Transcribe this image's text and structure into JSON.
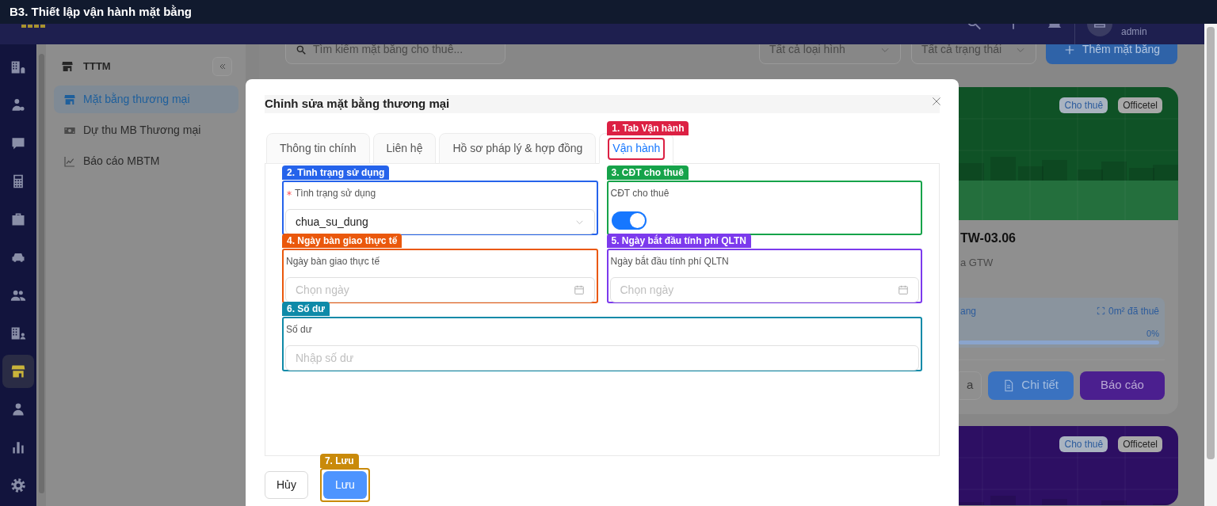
{
  "banner": {
    "title": "B3. Thiết lập vận hành mặt bằng"
  },
  "header": {
    "user": "admin"
  },
  "rail": [
    {
      "kind": "building",
      "selected": false
    },
    {
      "kind": "person_coin",
      "selected": false
    },
    {
      "kind": "chat",
      "selected": false
    },
    {
      "kind": "calculator",
      "selected": false
    },
    {
      "kind": "briefcase",
      "selected": false
    },
    {
      "kind": "car",
      "selected": false
    },
    {
      "kind": "people",
      "selected": false
    },
    {
      "kind": "building_person",
      "selected": false
    },
    {
      "kind": "store",
      "selected": true
    },
    {
      "kind": "person",
      "selected": false
    },
    {
      "kind": "chart",
      "selected": false
    },
    {
      "kind": "settings",
      "selected": false
    }
  ],
  "sidebar": {
    "title": "TTTM",
    "items": [
      {
        "label": "Mặt bằng thương mại",
        "kind": "store",
        "selected": true
      },
      {
        "label": "Dự thu MB Thương mại",
        "kind": "cash",
        "selected": false
      },
      {
        "label": "Báo cáo MBTM",
        "kind": "chart",
        "selected": false
      }
    ]
  },
  "toolbar": {
    "search_placeholder": "Tìm kiếm mặt bằng cho thuê...",
    "filters": [
      {
        "placeholder": "Tất cả loại hình"
      },
      {
        "placeholder": "Tất cả trạng thái"
      }
    ],
    "add_button": "Thêm mặt bằng"
  },
  "cards": [
    {
      "color": "#0f5226",
      "badges": [
        {
          "label": "Cho thuê",
          "kind": "status"
        },
        {
          "label": "Officetel",
          "kind": "type"
        }
      ],
      "title": "TW-03.06",
      "subtitle": "a GTW",
      "area_label": "ang",
      "rented": "0m² đã thuê",
      "percent": "0%",
      "level": 0,
      "buttons": [
        {
          "label": "a",
          "kind": "outline"
        },
        {
          "label": "Chi tiết",
          "kind": "detail"
        },
        {
          "label": "Báo cáo",
          "kind": "report"
        }
      ]
    },
    {
      "color": "#2d0f63",
      "badges": [
        {
          "label": "Cho thuê",
          "kind": "status"
        },
        {
          "label": "Officetel",
          "kind": "type"
        }
      ]
    }
  ],
  "modal": {
    "title": "Chỉnh sửa mặt bằng thương mại",
    "tabs": [
      {
        "label": "Thông tin chính",
        "selected": false
      },
      {
        "label": "Liên hệ",
        "selected": false
      },
      {
        "label": "Hồ sơ pháp lý & hợp đồng",
        "selected": false
      },
      {
        "label": "Vận hành",
        "selected": true,
        "annotation": {
          "label": "1. Tab Vận hành",
          "color": "#dc2043"
        }
      }
    ],
    "fields": [
      {
        "kind": "select",
        "label": "Tình trạng sử dụng",
        "required": true,
        "value": "chua_su_dung",
        "annotation": {
          "label": "2. Tình trạng sử dụng",
          "color": "#2563eb"
        }
      },
      {
        "kind": "toggle",
        "label": "CĐT cho thuê",
        "required": false,
        "on": true,
        "annotation": {
          "label": "3. CĐT cho thuê",
          "color": "#16a34a"
        }
      },
      {
        "kind": "date",
        "label": "Ngày bàn giao thực tế",
        "required": false,
        "placeholder": "Chọn ngày",
        "annotation": {
          "label": "4. Ngày bàn giao thực tế",
          "color": "#ea580c"
        }
      },
      {
        "kind": "date",
        "label": "Ngày bắt đầu tính phí QLTN",
        "required": false,
        "placeholder": "Chọn ngày",
        "annotation": {
          "label": "5. Ngày bắt đầu tính phí QLTN",
          "color": "#7c3aed"
        }
      },
      {
        "kind": "text",
        "label": "Số dư",
        "required": false,
        "placeholder": "Nhập số dư",
        "annotation": {
          "label": "6. Số dư",
          "color": "#0e8aa8"
        }
      }
    ],
    "buttons": [
      {
        "label": "Hủy",
        "kind": "secondary"
      },
      {
        "label": "Lưu",
        "kind": "primary",
        "annotation": {
          "label": "7. Lưu",
          "color": "#c98a0a"
        }
      }
    ]
  }
}
